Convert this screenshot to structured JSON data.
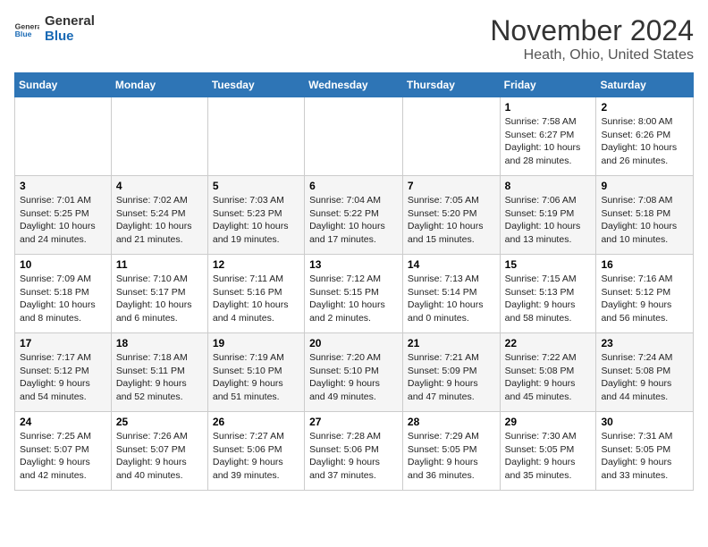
{
  "header": {
    "logo": {
      "general": "General",
      "blue": "Blue"
    },
    "title": "November 2024",
    "location": "Heath, Ohio, United States"
  },
  "weekdays": [
    "Sunday",
    "Monday",
    "Tuesday",
    "Wednesday",
    "Thursday",
    "Friday",
    "Saturday"
  ],
  "weeks": [
    [
      {
        "day": "",
        "info": ""
      },
      {
        "day": "",
        "info": ""
      },
      {
        "day": "",
        "info": ""
      },
      {
        "day": "",
        "info": ""
      },
      {
        "day": "",
        "info": ""
      },
      {
        "day": "1",
        "info": "Sunrise: 7:58 AM\nSunset: 6:27 PM\nDaylight: 10 hours\nand 28 minutes."
      },
      {
        "day": "2",
        "info": "Sunrise: 8:00 AM\nSunset: 6:26 PM\nDaylight: 10 hours\nand 26 minutes."
      }
    ],
    [
      {
        "day": "3",
        "info": "Sunrise: 7:01 AM\nSunset: 5:25 PM\nDaylight: 10 hours\nand 24 minutes."
      },
      {
        "day": "4",
        "info": "Sunrise: 7:02 AM\nSunset: 5:24 PM\nDaylight: 10 hours\nand 21 minutes."
      },
      {
        "day": "5",
        "info": "Sunrise: 7:03 AM\nSunset: 5:23 PM\nDaylight: 10 hours\nand 19 minutes."
      },
      {
        "day": "6",
        "info": "Sunrise: 7:04 AM\nSunset: 5:22 PM\nDaylight: 10 hours\nand 17 minutes."
      },
      {
        "day": "7",
        "info": "Sunrise: 7:05 AM\nSunset: 5:20 PM\nDaylight: 10 hours\nand 15 minutes."
      },
      {
        "day": "8",
        "info": "Sunrise: 7:06 AM\nSunset: 5:19 PM\nDaylight: 10 hours\nand 13 minutes."
      },
      {
        "day": "9",
        "info": "Sunrise: 7:08 AM\nSunset: 5:18 PM\nDaylight: 10 hours\nand 10 minutes."
      }
    ],
    [
      {
        "day": "10",
        "info": "Sunrise: 7:09 AM\nSunset: 5:18 PM\nDaylight: 10 hours\nand 8 minutes."
      },
      {
        "day": "11",
        "info": "Sunrise: 7:10 AM\nSunset: 5:17 PM\nDaylight: 10 hours\nand 6 minutes."
      },
      {
        "day": "12",
        "info": "Sunrise: 7:11 AM\nSunset: 5:16 PM\nDaylight: 10 hours\nand 4 minutes."
      },
      {
        "day": "13",
        "info": "Sunrise: 7:12 AM\nSunset: 5:15 PM\nDaylight: 10 hours\nand 2 minutes."
      },
      {
        "day": "14",
        "info": "Sunrise: 7:13 AM\nSunset: 5:14 PM\nDaylight: 10 hours\nand 0 minutes."
      },
      {
        "day": "15",
        "info": "Sunrise: 7:15 AM\nSunset: 5:13 PM\nDaylight: 9 hours\nand 58 minutes."
      },
      {
        "day": "16",
        "info": "Sunrise: 7:16 AM\nSunset: 5:12 PM\nDaylight: 9 hours\nand 56 minutes."
      }
    ],
    [
      {
        "day": "17",
        "info": "Sunrise: 7:17 AM\nSunset: 5:12 PM\nDaylight: 9 hours\nand 54 minutes."
      },
      {
        "day": "18",
        "info": "Sunrise: 7:18 AM\nSunset: 5:11 PM\nDaylight: 9 hours\nand 52 minutes."
      },
      {
        "day": "19",
        "info": "Sunrise: 7:19 AM\nSunset: 5:10 PM\nDaylight: 9 hours\nand 51 minutes."
      },
      {
        "day": "20",
        "info": "Sunrise: 7:20 AM\nSunset: 5:10 PM\nDaylight: 9 hours\nand 49 minutes."
      },
      {
        "day": "21",
        "info": "Sunrise: 7:21 AM\nSunset: 5:09 PM\nDaylight: 9 hours\nand 47 minutes."
      },
      {
        "day": "22",
        "info": "Sunrise: 7:22 AM\nSunset: 5:08 PM\nDaylight: 9 hours\nand 45 minutes."
      },
      {
        "day": "23",
        "info": "Sunrise: 7:24 AM\nSunset: 5:08 PM\nDaylight: 9 hours\nand 44 minutes."
      }
    ],
    [
      {
        "day": "24",
        "info": "Sunrise: 7:25 AM\nSunset: 5:07 PM\nDaylight: 9 hours\nand 42 minutes."
      },
      {
        "day": "25",
        "info": "Sunrise: 7:26 AM\nSunset: 5:07 PM\nDaylight: 9 hours\nand 40 minutes."
      },
      {
        "day": "26",
        "info": "Sunrise: 7:27 AM\nSunset: 5:06 PM\nDaylight: 9 hours\nand 39 minutes."
      },
      {
        "day": "27",
        "info": "Sunrise: 7:28 AM\nSunset: 5:06 PM\nDaylight: 9 hours\nand 37 minutes."
      },
      {
        "day": "28",
        "info": "Sunrise: 7:29 AM\nSunset: 5:05 PM\nDaylight: 9 hours\nand 36 minutes."
      },
      {
        "day": "29",
        "info": "Sunrise: 7:30 AM\nSunset: 5:05 PM\nDaylight: 9 hours\nand 35 minutes."
      },
      {
        "day": "30",
        "info": "Sunrise: 7:31 AM\nSunset: 5:05 PM\nDaylight: 9 hours\nand 33 minutes."
      }
    ]
  ]
}
